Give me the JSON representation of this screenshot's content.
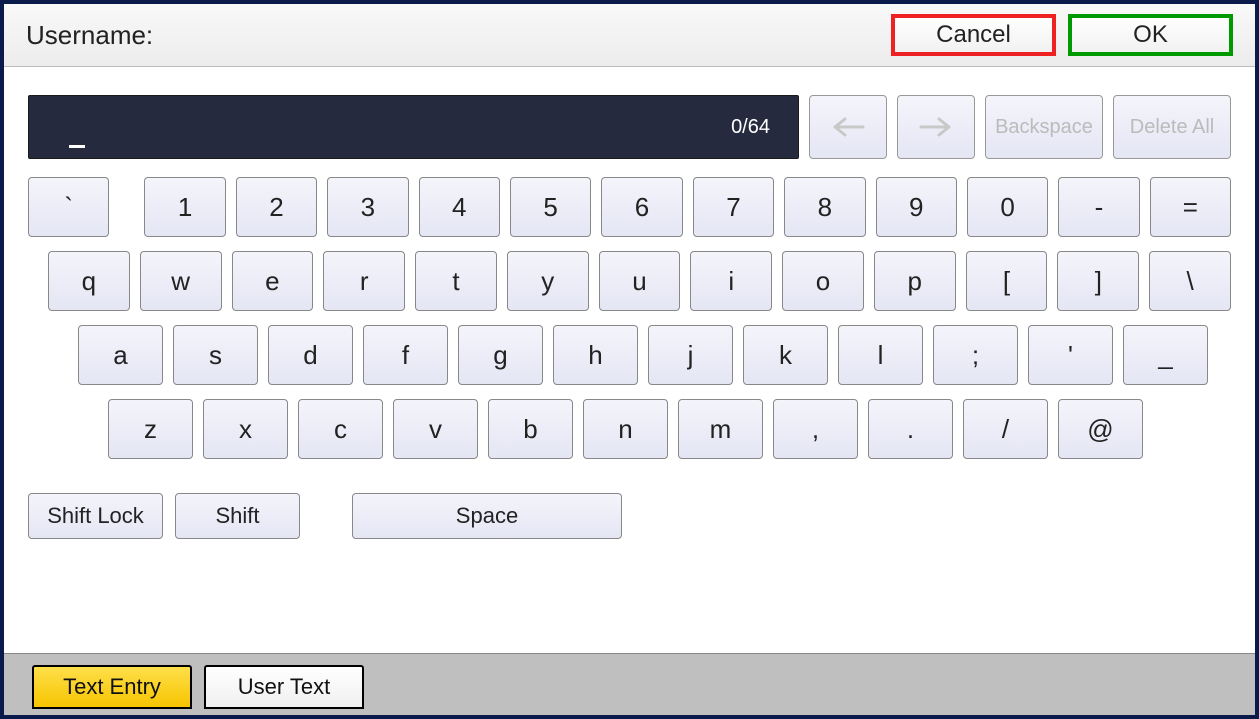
{
  "header": {
    "label": "Username:",
    "cancel": "Cancel",
    "ok": "OK"
  },
  "input": {
    "value": "",
    "counter": "0/64"
  },
  "nav": {
    "backspace": "Backspace",
    "deleteAll": "Delete All"
  },
  "kbd": {
    "row1": [
      "`",
      "1",
      "2",
      "3",
      "4",
      "5",
      "6",
      "7",
      "8",
      "9",
      "0",
      "-",
      "="
    ],
    "row2": [
      "q",
      "w",
      "e",
      "r",
      "t",
      "y",
      "u",
      "i",
      "o",
      "p",
      "[",
      "]",
      "\\"
    ],
    "row3": [
      "a",
      "s",
      "d",
      "f",
      "g",
      "h",
      "j",
      "k",
      "l",
      ";",
      "'",
      "_"
    ],
    "row4": [
      "z",
      "x",
      "c",
      "v",
      "b",
      "n",
      "m",
      ",",
      ".",
      "/",
      "@"
    ]
  },
  "ctrl": {
    "shiftLock": "Shift Lock",
    "shift": "Shift",
    "space": "Space"
  },
  "tabs": {
    "textEntry": "Text Entry",
    "userText": "User Text"
  }
}
